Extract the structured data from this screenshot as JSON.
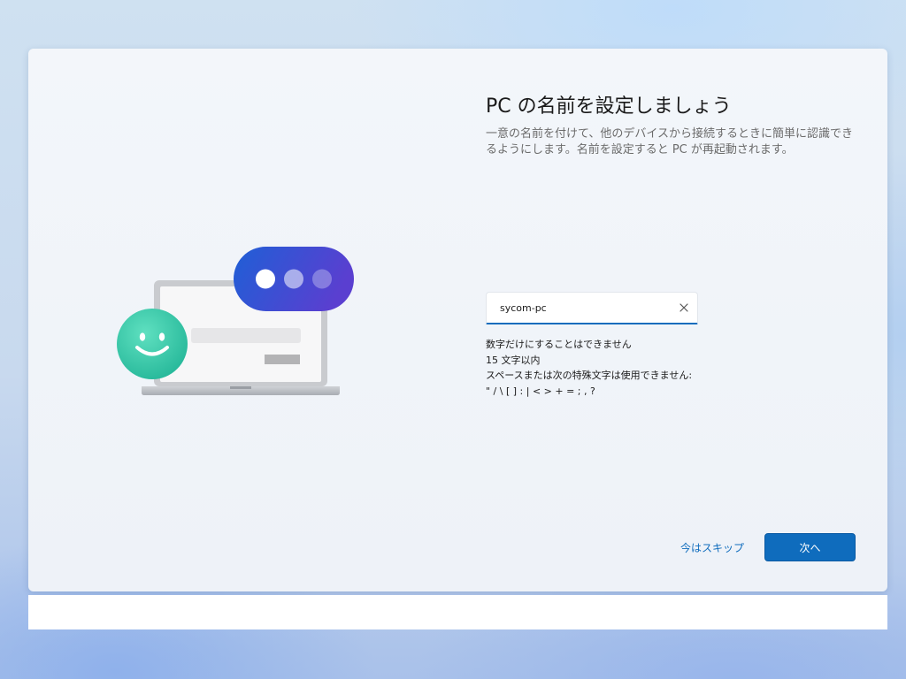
{
  "page": {
    "title": "PC の名前を設定しましょう",
    "description": "一意の名前を付けて、他のデバイスから接続するときに簡単に認識できるようにします。名前を設定すると PC が再起動されます。"
  },
  "pc_name_input": {
    "value": "sycom-pc",
    "clear_icon": "close-icon"
  },
  "rules": [
    "数字だけにすることはできません",
    "15 文字以内",
    "スペースまたは次の特殊文字は使用できません:",
    "\" / \\ [ ] : | < > + = ; , ?"
  ],
  "buttons": {
    "skip_label": "今はスキップ",
    "next_label": "次へ"
  },
  "illustration": {
    "icons": [
      "laptop-icon",
      "smiley-face-icon",
      "chat-bubble-icon"
    ]
  },
  "colors": {
    "accent": "#0f6cbd",
    "smiley": "#3fcba9",
    "bubble_start": "#1f5fd6",
    "bubble_end": "#5a3fd0"
  }
}
